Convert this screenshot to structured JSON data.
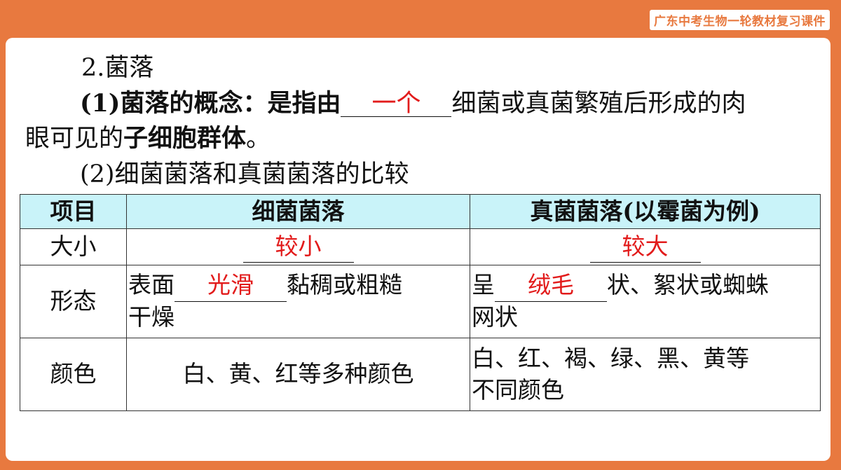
{
  "brand": "广东中考生物一轮教材复习课件",
  "heading": "2.菌落",
  "concept": {
    "prefix": "(1)菌落的概念：是指由",
    "answer": "一个",
    "suffix": "细菌或真菌繁殖后形成的肉",
    "line2_a": "眼可见的",
    "line2_b": "子细胞群体",
    "line2_c": "。"
  },
  "compare_title": "(2)细菌菌落和真菌菌落的比较",
  "table": {
    "headers": [
      "项目",
      "细菌菌落",
      "真菌菌落(以霉菌为例)"
    ],
    "size": {
      "label": "大小",
      "bacteria": "较小",
      "fungi": "较大"
    },
    "shape": {
      "label": "形态",
      "bacteria_prefix": "表面",
      "bacteria_answer": "光滑",
      "bacteria_suffix": "黏稠或粗糙",
      "bacteria_line2": "干燥",
      "fungi_prefix": "呈",
      "fungi_answer": "绒毛",
      "fungi_suffix": "状、絮状或蜘蛛",
      "fungi_line2": "网状"
    },
    "color": {
      "label": "颜色",
      "bacteria": "白、黄、红等多种颜色",
      "fungi_line1": "白、红、褐、绿、黑、黄等",
      "fungi_line2": "不同颜色"
    }
  },
  "colors": {
    "accent": "#e8793f",
    "answer_red": "#e21b1b",
    "header_bg": "#c9f3f9"
  }
}
